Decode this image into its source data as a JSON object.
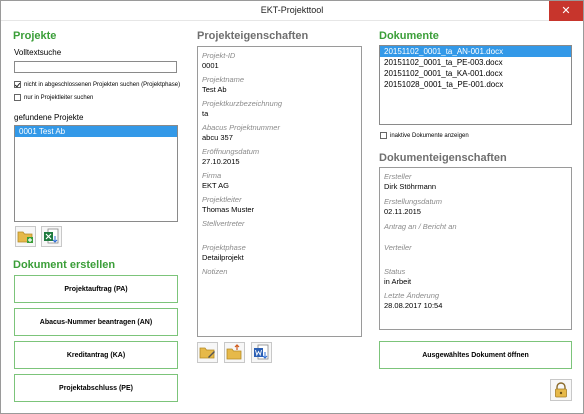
{
  "window": {
    "title": "EKT-Projekttool",
    "close_glyph": "✕"
  },
  "projekte": {
    "heading": "Projekte",
    "search_label": "Volltextsuche",
    "search_value": "",
    "cb_closed": {
      "label": "nicht in abgeschlossenen Projekten suchen (Projektphase)",
      "checked": true
    },
    "cb_leader": {
      "label": "nur in Projektleiter suchen",
      "checked": false
    },
    "found_label": "gefundene Projekte",
    "found_items": [
      "0001 Test Ab"
    ]
  },
  "dokument_erstellen": {
    "heading": "Dokument erstellen",
    "buttons": [
      "Projektauftrag (PA)",
      "Abacus-Nummer beantragen (AN)",
      "Kreditantrag (KA)",
      "Projektabschluss (PE)"
    ]
  },
  "projekteigenschaften": {
    "heading": "Projekteigenschaften",
    "fields": [
      {
        "label": "Projekt-ID",
        "value": "0001"
      },
      {
        "label": "Projektname",
        "value": "Test Ab"
      },
      {
        "label": "Projektkurzbezeichnung",
        "value": "ta"
      },
      {
        "label": "Abacus Projektnummer",
        "value": "abcu 357"
      },
      {
        "label": "Eröffnungsdatum",
        "value": "27.10.2015"
      },
      {
        "label": "Firma",
        "value": "EKT AG"
      },
      {
        "label": "Projektleiter",
        "value": "Thomas Muster"
      },
      {
        "label": "Stellvertreter",
        "value": ""
      },
      {
        "label": "Projektphase",
        "value": "Detailprojekt"
      },
      {
        "label": "Notizen",
        "value": ""
      }
    ]
  },
  "dokumente": {
    "heading": "Dokumente",
    "items": [
      "20151102_0001_ta_AN-001.docx",
      "20151102_0001_ta_PE-003.docx",
      "20151102_0001_ta_KA-001.docx",
      "20151028_0001_ta_PE-001.docx"
    ],
    "inactive_cb": {
      "label": "inaktive Dokumente anzeigen",
      "checked": false
    }
  },
  "dokumenteigenschaften": {
    "heading": "Dokumenteigenschaften",
    "fields": [
      {
        "label": "Ersteller",
        "value": "Dirk Stöhrmann"
      },
      {
        "label": "Erstellungsdatum",
        "value": "02.11.2015"
      },
      {
        "label": "Antrag an / Bericht an",
        "value": ""
      },
      {
        "label": "Verteiler",
        "value": ""
      },
      {
        "label": "Status",
        "value": "in Arbeit"
      },
      {
        "label": "Letzte Änderung",
        "value": "28.08.2017 10:54"
      }
    ],
    "open_button": "Ausgewähltes Dokument öffnen"
  },
  "icons": {
    "new_folder": "new-folder-icon",
    "excel_export": "excel-export-icon",
    "edit_folder": "edit-folder-icon",
    "folder_upload": "folder-upload-icon",
    "word_doc": "word-document-icon",
    "lock": "lock-icon"
  },
  "colors": {
    "accent_green": "#3a9e38",
    "selection_blue": "#3399e8",
    "close_red": "#c7352c"
  }
}
